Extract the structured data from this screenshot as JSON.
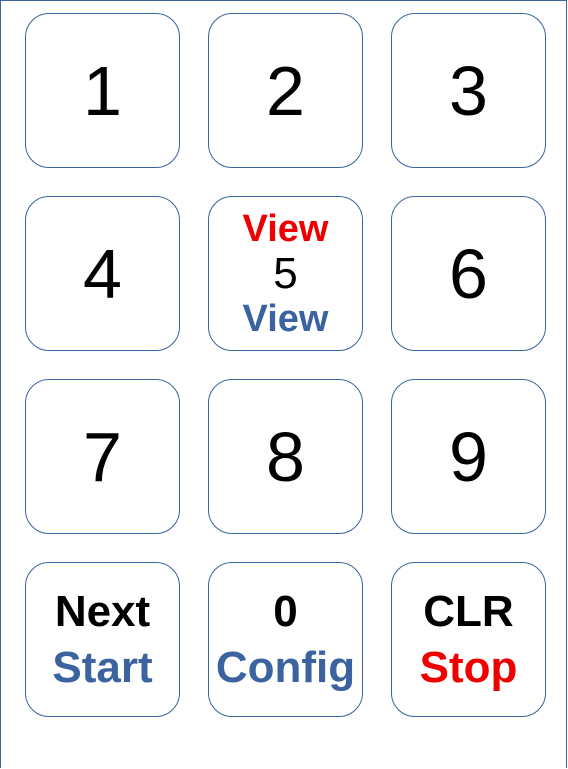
{
  "colors": {
    "border": "#3a63a0",
    "blue_text": "#3a63a0",
    "red_text": "#ee0000",
    "black_text": "#000000"
  },
  "keypad": {
    "key_1": "1",
    "key_2": "2",
    "key_3": "3",
    "key_4": "4",
    "key_5": {
      "top": "View",
      "digit": "5",
      "bottom": "View"
    },
    "key_6": "6",
    "key_7": "7",
    "key_8": "8",
    "key_9": "9",
    "key_next": {
      "primary": "Next",
      "secondary": "Start"
    },
    "key_0": {
      "primary": "0",
      "secondary": "Config"
    },
    "key_clr": {
      "primary": "CLR",
      "secondary": "Stop"
    }
  }
}
